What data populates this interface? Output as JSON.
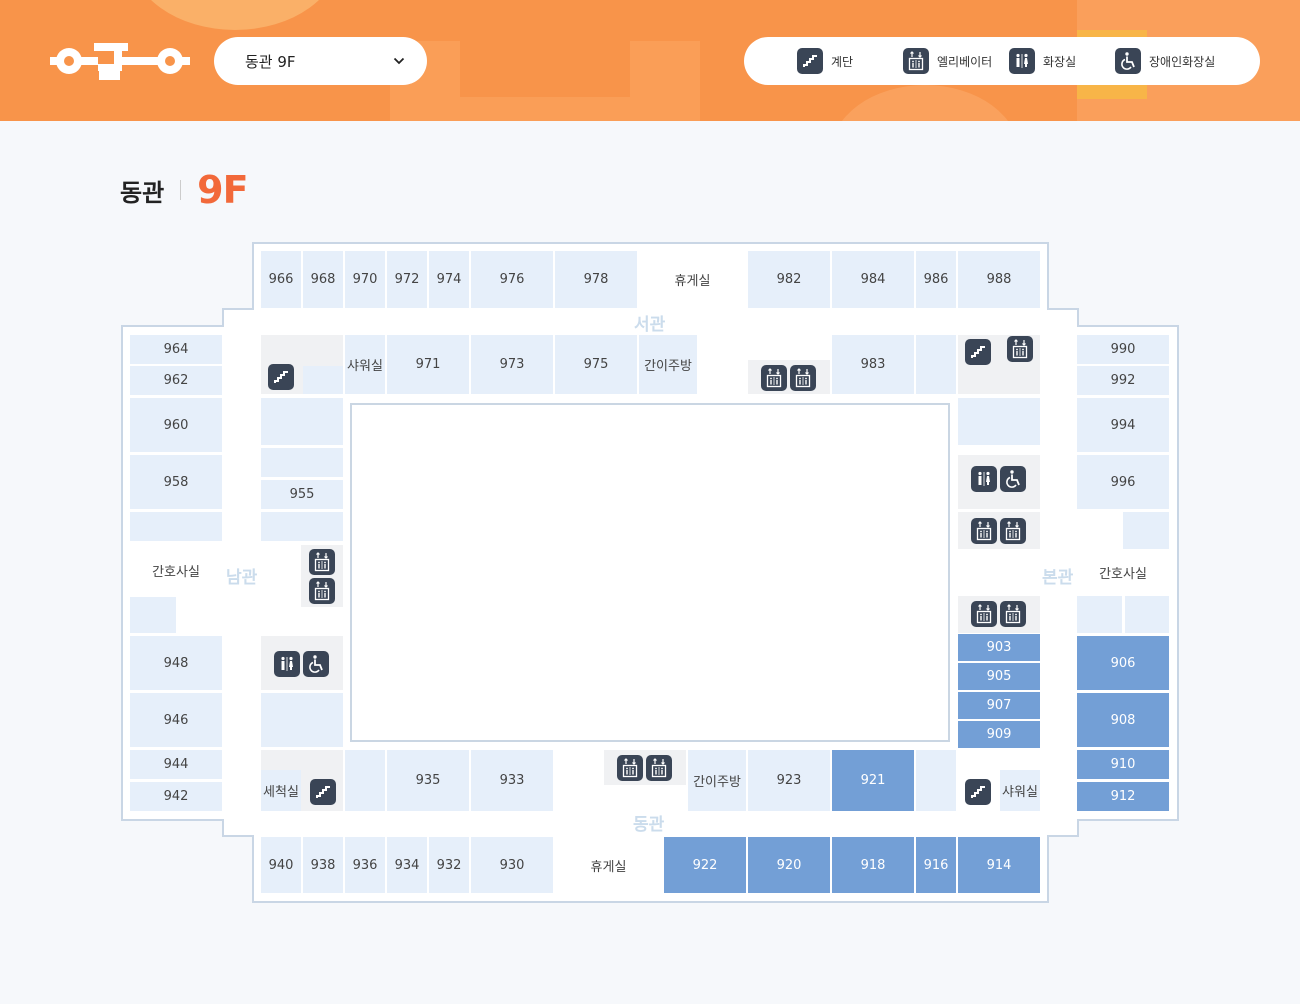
{
  "header": {
    "floor_select": {
      "value": "동관 9F"
    },
    "legend": [
      {
        "icon": "stairs-icon",
        "label": "계단"
      },
      {
        "icon": "elevator-icon",
        "label": "엘리베이터"
      },
      {
        "icon": "restroom-icon",
        "label": "화장실"
      },
      {
        "icon": "accessible-restroom-icon",
        "label": "장애인화장실"
      }
    ]
  },
  "title": {
    "building": "동관",
    "floor": "9F"
  },
  "colors": {
    "accent": "#f8944a",
    "floor_text": "#f2693a",
    "room": "#e6effa",
    "room_highlight": "#739fd6",
    "icon_bg": "#3a4556"
  },
  "wings": {
    "west": "서관",
    "south": "남관",
    "main": "본관",
    "east": "동관"
  },
  "rooms": {
    "r966": "966",
    "r968": "968",
    "r970": "970",
    "r972": "972",
    "r974": "974",
    "r976": "976",
    "r978": "978",
    "lounge_top": "휴게실",
    "r982": "982",
    "r984": "984",
    "r986": "986",
    "r988": "988",
    "shower_left": "샤워실",
    "r971": "971",
    "r973": "973",
    "r975": "975",
    "kitchen_top": "간이주방",
    "r983": "983",
    "r964": "964",
    "r962": "962",
    "r960": "960",
    "r958": "958",
    "nurse_left": "간호사실",
    "r955": "955",
    "r948": "948",
    "r946": "946",
    "r944": "944",
    "r942": "942",
    "laundry": "세척실",
    "r935": "935",
    "r933": "933",
    "kitchen_bottom": "간이주방",
    "r923": "923",
    "r921": "921",
    "shower_right": "샤워실",
    "r990": "990",
    "r992": "992",
    "r994": "994",
    "r996": "996",
    "nurse_right": "간호사실",
    "r903": "903",
    "r905": "905",
    "r907": "907",
    "r909": "909",
    "r906": "906",
    "r908": "908",
    "r910": "910",
    "r912": "912",
    "r940": "940",
    "r938": "938",
    "r936": "936",
    "r934": "934",
    "r932": "932",
    "r930": "930",
    "lounge_bottom": "휴게실",
    "r922": "922",
    "r920": "920",
    "r918": "918",
    "r916": "916",
    "r914": "914"
  }
}
